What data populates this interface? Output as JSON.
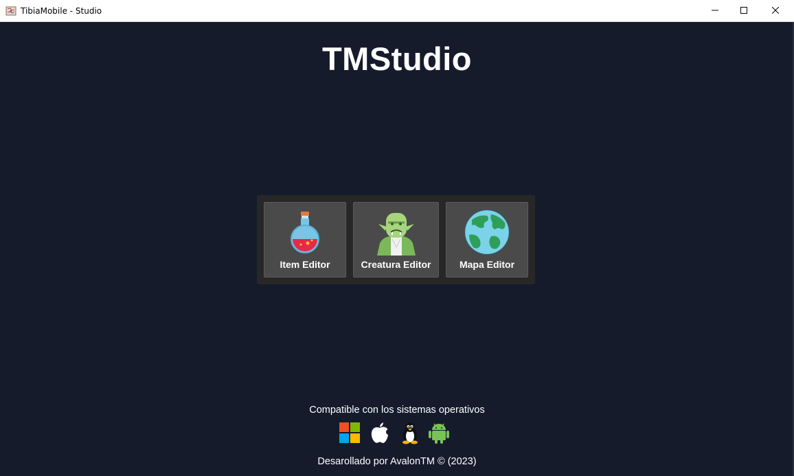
{
  "window": {
    "title": "TibiaMobile - Studio",
    "app_icon": "map-app-icon",
    "controls": [
      "minimize-icon",
      "maximize-icon",
      "close-icon"
    ]
  },
  "main": {
    "title": "TMStudio",
    "cards": [
      {
        "label": "Item Editor",
        "icon": "potion-flask-icon"
      },
      {
        "label": "Creatura Editor",
        "icon": "orc-creature-icon"
      },
      {
        "label": "Mapa Editor",
        "icon": "globe-icon"
      }
    ]
  },
  "footer": {
    "compat_text": "Compatible con los sistemas operativos",
    "os_icons": [
      "windows-icon",
      "apple-icon",
      "linux-tux-icon",
      "android-icon"
    ],
    "credit": "Desarollado por AvalonTM © (2023)"
  },
  "colors": {
    "background": "#161b2c",
    "panel": "#272727",
    "card": "#4a4a4a",
    "text": "#ffffff"
  }
}
